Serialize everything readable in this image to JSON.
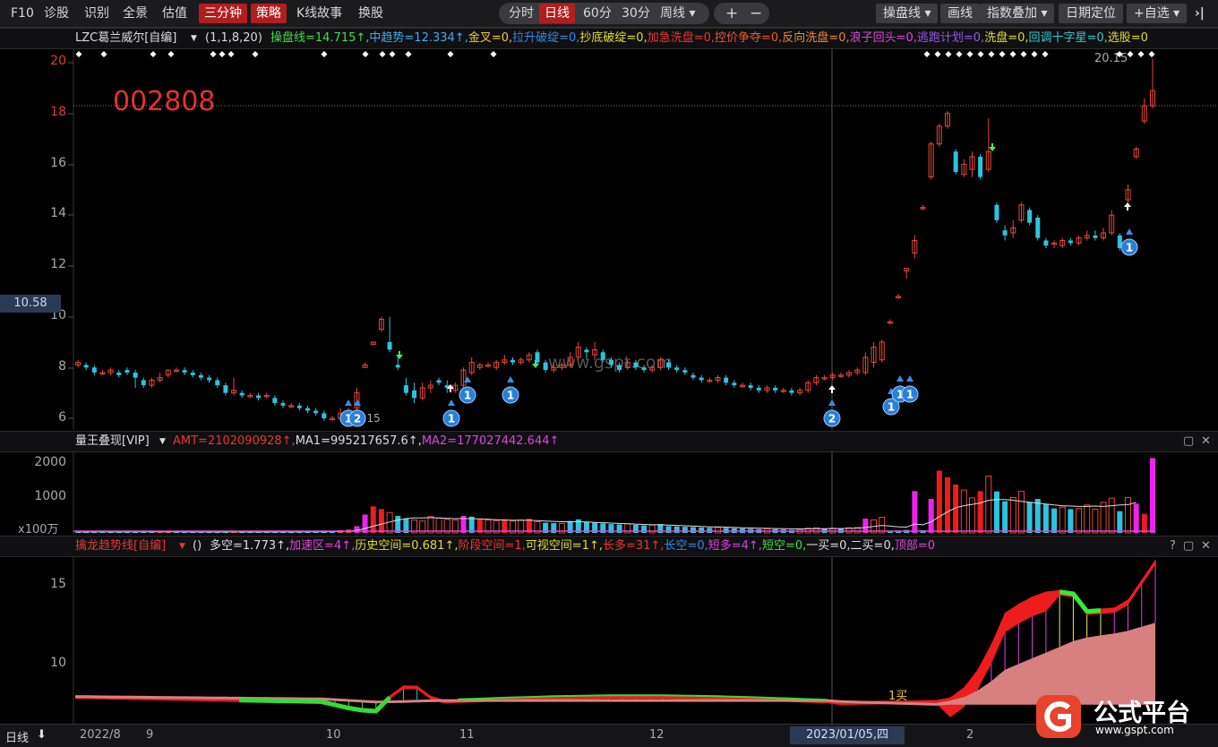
{
  "toolbar": {
    "left_items": [
      "F10",
      "诊股",
      "识别",
      "全景",
      "估值",
      "三分钟",
      "策略",
      "K线故事",
      "换股"
    ],
    "period_tabs": [
      "分时",
      "日线",
      "60分",
      "30分",
      "周线"
    ],
    "active_tab": "日线",
    "plus": "+",
    "minus": "−",
    "right_items": [
      "操盘线",
      "画线",
      "指数叠加",
      "日期定位",
      "自选"
    ],
    "exit_icon": "›|"
  },
  "stock_code": "002808",
  "main_indicator": {
    "name": "LZC葛兰威尔[自编]",
    "params": "(1,1,8,20)",
    "values": [
      {
        "text": "操盘线=14.715↑",
        "color": "#44dd44"
      },
      {
        "text": "中趋势=12.334↑",
        "color": "#44aaee"
      },
      {
        "text": "金叉=0",
        "color": "#eecc33"
      },
      {
        "text": "拉升破绽=0",
        "color": "#3388ee"
      },
      {
        "text": "抄底破绽=0",
        "color": "#dddd33"
      },
      {
        "text": "加急洗盘=0",
        "color": "#ee3333"
      },
      {
        "text": "控价争夺=0",
        "color": "#ee5533"
      },
      {
        "text": "反向洗盘=0",
        "color": "#ee8833"
      },
      {
        "text": "浪子回头=0",
        "color": "#dd44dd"
      },
      {
        "text": "逃跑计划=0",
        "color": "#9955ee"
      },
      {
        "text": "洗盘=0",
        "color": "#dddd33"
      },
      {
        "text": "回调十字星=0",
        "color": "#33cccc"
      },
      {
        "text": "选股=0",
        "color": "#dddd33"
      }
    ]
  },
  "price_axis": [
    "20",
    "18",
    "16",
    "14",
    "12",
    "10",
    "8",
    "6"
  ],
  "current_price": "10.58",
  "high_label": "20.15",
  "watermark": "www.gspt.com",
  "low_label": "5.15",
  "volume_indicator": {
    "name": "量王叠现[VIP]",
    "values": [
      {
        "text": "AMT=2102090928↑",
        "color": "#ee3333"
      },
      {
        "text": "MA1=995217657.6↑",
        "color": "#dddddd"
      },
      {
        "text": "MA2=177027442.644↑",
        "color": "#dd44dd"
      }
    ]
  },
  "volume_axis": [
    "2000",
    "1000"
  ],
  "volume_unit": "x100万",
  "trend_indicator": {
    "name": "擒龙趋势线[自编]",
    "params": "()",
    "values": [
      {
        "text": "多空=1.773↑",
        "color": "#dddddd"
      },
      {
        "text": "加速区=4↑",
        "color": "#dd44dd"
      },
      {
        "text": "历史空间=0.681↑",
        "color": "#dddd33"
      },
      {
        "text": "阶段空间=1",
        "color": "#ee3333"
      },
      {
        "text": "可视空间=1↑",
        "color": "#dddd33"
      },
      {
        "text": "长多=31↑",
        "color": "#ee3333"
      },
      {
        "text": "长空=0",
        "color": "#3388ee"
      },
      {
        "text": "短多=4↑",
        "color": "#dd44dd"
      },
      {
        "text": "短空=0",
        "color": "#44dd44"
      },
      {
        "text": "一买=0",
        "color": "#dddddd"
      },
      {
        "text": "二买=0",
        "color": "#dddddd"
      },
      {
        "text": "顶部=0",
        "color": "#dd44dd"
      }
    ],
    "buy_label": "1买"
  },
  "trend_axis": [
    "15",
    "10"
  ],
  "period_label": "日线",
  "dates": [
    "2022/8",
    "9",
    "10",
    "11",
    "12",
    "2023/01/05,四",
    "2"
  ],
  "logo": {
    "text": "公式平台",
    "url": "www.gspt.com"
  }
}
